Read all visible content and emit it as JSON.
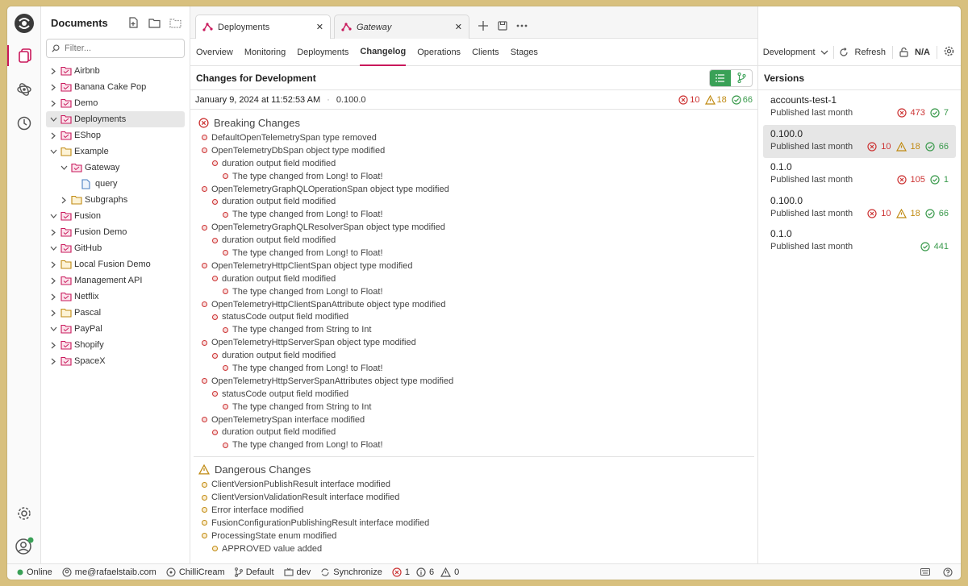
{
  "sidebar": {
    "title": "Documents",
    "filter_placeholder": "Filter...",
    "items": [
      {
        "label": "Airbnb",
        "depth": 0,
        "expanded": false,
        "icon": "pink-folder-icon"
      },
      {
        "label": "Banana Cake Pop",
        "depth": 0,
        "expanded": false,
        "icon": "pink-folder-icon"
      },
      {
        "label": "Demo",
        "depth": 0,
        "expanded": false,
        "icon": "pink-folder-icon"
      },
      {
        "label": "Deployments",
        "depth": 0,
        "expanded": true,
        "selected": true,
        "icon": "pink-folder-icon"
      },
      {
        "label": "EShop",
        "depth": 0,
        "expanded": false,
        "icon": "pink-folder-icon"
      },
      {
        "label": "Example",
        "depth": 0,
        "expanded": true,
        "icon": "yellow-folder-icon"
      },
      {
        "label": "Gateway",
        "depth": 1,
        "expanded": true,
        "icon": "pink-folder-icon"
      },
      {
        "label": "query",
        "depth": 2,
        "expanded": null,
        "icon": "document-icon"
      },
      {
        "label": "Subgraphs",
        "depth": 1,
        "expanded": false,
        "icon": "yellow-folder-icon"
      },
      {
        "label": "Fusion",
        "depth": 0,
        "expanded": true,
        "icon": "pink-folder-icon"
      },
      {
        "label": "Fusion Demo",
        "depth": 0,
        "expanded": false,
        "icon": "pink-folder-icon"
      },
      {
        "label": "GitHub",
        "depth": 0,
        "expanded": true,
        "icon": "pink-folder-icon"
      },
      {
        "label": "Local Fusion Demo",
        "depth": 0,
        "expanded": false,
        "icon": "yellow-folder-icon"
      },
      {
        "label": "Management API",
        "depth": 0,
        "expanded": false,
        "icon": "pink-folder-icon"
      },
      {
        "label": "Netflix",
        "depth": 0,
        "expanded": false,
        "icon": "pink-folder-icon"
      },
      {
        "label": "Pascal",
        "depth": 0,
        "expanded": false,
        "icon": "yellow-folder-icon"
      },
      {
        "label": "PayPal",
        "depth": 0,
        "expanded": true,
        "icon": "pink-folder-icon"
      },
      {
        "label": "Shopify",
        "depth": 0,
        "expanded": false,
        "icon": "pink-folder-icon"
      },
      {
        "label": "SpaceX",
        "depth": 0,
        "expanded": false,
        "icon": "pink-folder-icon"
      }
    ]
  },
  "tabs": [
    {
      "label": "Deployments",
      "active": true,
      "italic": false
    },
    {
      "label": "Gateway",
      "active": false,
      "italic": true
    }
  ],
  "subnav": [
    "Overview",
    "Monitoring",
    "Deployments",
    "Changelog",
    "Operations",
    "Clients",
    "Stages"
  ],
  "subnav_active": "Changelog",
  "toolbar": {
    "environment": "Development",
    "refresh_label": "Refresh",
    "lock_label": "N/A"
  },
  "changes": {
    "title": "Changes for Development",
    "date": "January 9, 2024 at 11:52:53 AM",
    "version": "0.100.0",
    "counts": {
      "breaking": "10",
      "dangerous": "18",
      "safe": "66"
    },
    "breaking_title": "Breaking Changes",
    "breaking": [
      {
        "text": "DefaultOpenTelemetrySpan type removed",
        "level": 0
      },
      {
        "text": "OpenTelemetryDbSpan object type modified",
        "level": 0
      },
      {
        "text": "duration output field modified",
        "level": 1
      },
      {
        "text": "The type changed from Long! to Float!",
        "level": 2
      },
      {
        "text": "OpenTelemetryGraphQLOperationSpan object type modified",
        "level": 0
      },
      {
        "text": "duration output field modified",
        "level": 1
      },
      {
        "text": "The type changed from Long! to Float!",
        "level": 2
      },
      {
        "text": "OpenTelemetryGraphQLResolverSpan object type modified",
        "level": 0
      },
      {
        "text": "duration output field modified",
        "level": 1
      },
      {
        "text": "The type changed from Long! to Float!",
        "level": 2
      },
      {
        "text": "OpenTelemetryHttpClientSpan object type modified",
        "level": 0
      },
      {
        "text": "duration output field modified",
        "level": 1
      },
      {
        "text": "The type changed from Long! to Float!",
        "level": 2
      },
      {
        "text": "OpenTelemetryHttpClientSpanAttribute object type modified",
        "level": 0
      },
      {
        "text": "statusCode output field modified",
        "level": 1
      },
      {
        "text": "The type changed from String to Int",
        "level": 2
      },
      {
        "text": "OpenTelemetryHttpServerSpan object type modified",
        "level": 0
      },
      {
        "text": "duration output field modified",
        "level": 1
      },
      {
        "text": "The type changed from Long! to Float!",
        "level": 2
      },
      {
        "text": "OpenTelemetryHttpServerSpanAttributes object type modified",
        "level": 0
      },
      {
        "text": "statusCode output field modified",
        "level": 1
      },
      {
        "text": "The type changed from String to Int",
        "level": 2
      },
      {
        "text": "OpenTelemetrySpan interface modified",
        "level": 0
      },
      {
        "text": "duration output field modified",
        "level": 1
      },
      {
        "text": "The type changed from Long! to Float!",
        "level": 2
      }
    ],
    "dangerous_title": "Dangerous Changes",
    "dangerous": [
      {
        "text": "ClientVersionPublishResult interface modified",
        "level": 0
      },
      {
        "text": "ClientVersionValidationResult interface modified",
        "level": 0
      },
      {
        "text": "Error interface modified",
        "level": 0
      },
      {
        "text": "FusionConfigurationPublishingResult interface modified",
        "level": 0
      },
      {
        "text": "ProcessingState enum modified",
        "level": 0
      },
      {
        "text": "APPROVED value added",
        "level": 1
      }
    ]
  },
  "versions": {
    "title": "Versions",
    "items": [
      {
        "name": "accounts-test-1",
        "published": "Published last month",
        "breaking": "473",
        "dangerous": null,
        "safe": "7",
        "selected": false
      },
      {
        "name": "0.100.0",
        "published": "Published last month",
        "breaking": "10",
        "dangerous": "18",
        "safe": "66",
        "selected": true
      },
      {
        "name": "0.1.0",
        "published": "Published last month",
        "breaking": "105",
        "dangerous": null,
        "safe": "1",
        "selected": false
      },
      {
        "name": "0.100.0",
        "published": "Published last month",
        "breaking": "10",
        "dangerous": "18",
        "safe": "66",
        "selected": false
      },
      {
        "name": "0.1.0",
        "published": "Published last month",
        "breaking": null,
        "dangerous": null,
        "safe": "441",
        "selected": false
      }
    ]
  },
  "status": {
    "online": "Online",
    "email": "me@rafaelstaib.com",
    "org": "ChilliCream",
    "branch": "Default",
    "env": "dev",
    "sync": "Synchronize",
    "errors": "1",
    "infos": "6",
    "warnings": "0"
  },
  "colors": {
    "accent": "#c9185b",
    "breaking": "#cc3333",
    "dangerous": "#c08a12",
    "safe": "#3a9a4c",
    "toggle_on": "#3aa157"
  }
}
